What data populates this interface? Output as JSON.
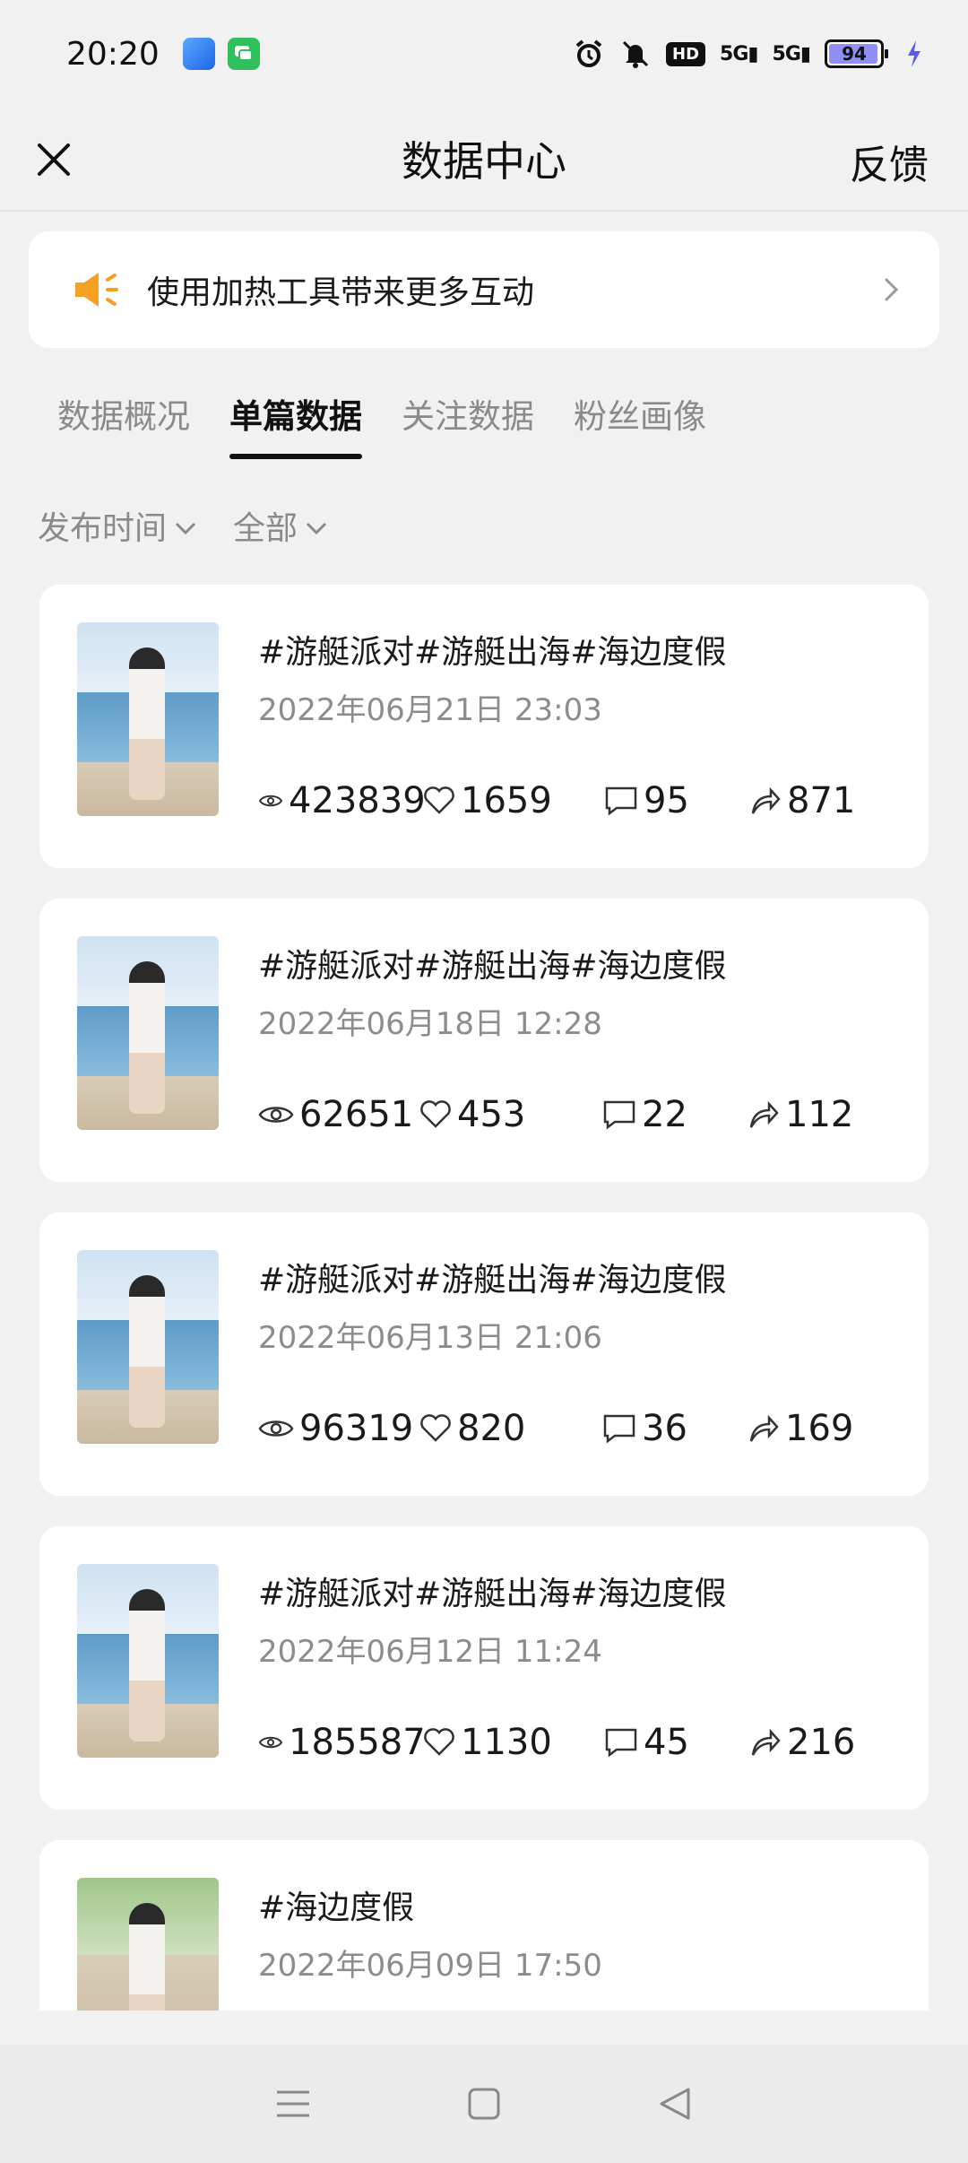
{
  "status_bar": {
    "time": "20:20",
    "battery": "94",
    "icons": [
      "alarm-icon",
      "mute-icon",
      "hd-icon",
      "signal-5g-icon",
      "signal-5g-icon",
      "battery-icon",
      "charging-icon"
    ],
    "hd_label": "HD",
    "network_label_1": "5G",
    "network_label_2": "5G"
  },
  "header": {
    "title": "数据中心",
    "feedback": "反馈",
    "close_icon": "close-icon"
  },
  "banner": {
    "text": "使用加热工具带来更多互动",
    "icon": "speaker-icon",
    "accent": "#f5a023"
  },
  "tabs": [
    {
      "label": "数据概况",
      "active": false
    },
    {
      "label": "单篇数据",
      "active": true
    },
    {
      "label": "关注数据",
      "active": false
    },
    {
      "label": "粉丝画像",
      "active": false
    }
  ],
  "filters": [
    {
      "label": "发布时间"
    },
    {
      "label": "全部"
    }
  ],
  "posts": [
    {
      "title": "#游艇派对#游艇出海#海边度假",
      "date": "2022年06月21日 23:03",
      "views": "423839",
      "likes": "1659",
      "comments": "95",
      "shares": "871"
    },
    {
      "title": "#游艇派对#游艇出海#海边度假",
      "date": "2022年06月18日 12:28",
      "views": "62651",
      "likes": "453",
      "comments": "22",
      "shares": "112"
    },
    {
      "title": "#游艇派对#游艇出海#海边度假",
      "date": "2022年06月13日 21:06",
      "views": "96319",
      "likes": "820",
      "comments": "36",
      "shares": "169"
    },
    {
      "title": "#游艇派对#游艇出海#海边度假",
      "date": "2022年06月12日 11:24",
      "views": "185587",
      "likes": "1130",
      "comments": "45",
      "shares": "216"
    },
    {
      "title": "#海边度假",
      "date": "2022年06月09日 17:50"
    }
  ],
  "nav": [
    "menu-icon",
    "home-icon",
    "back-icon"
  ]
}
